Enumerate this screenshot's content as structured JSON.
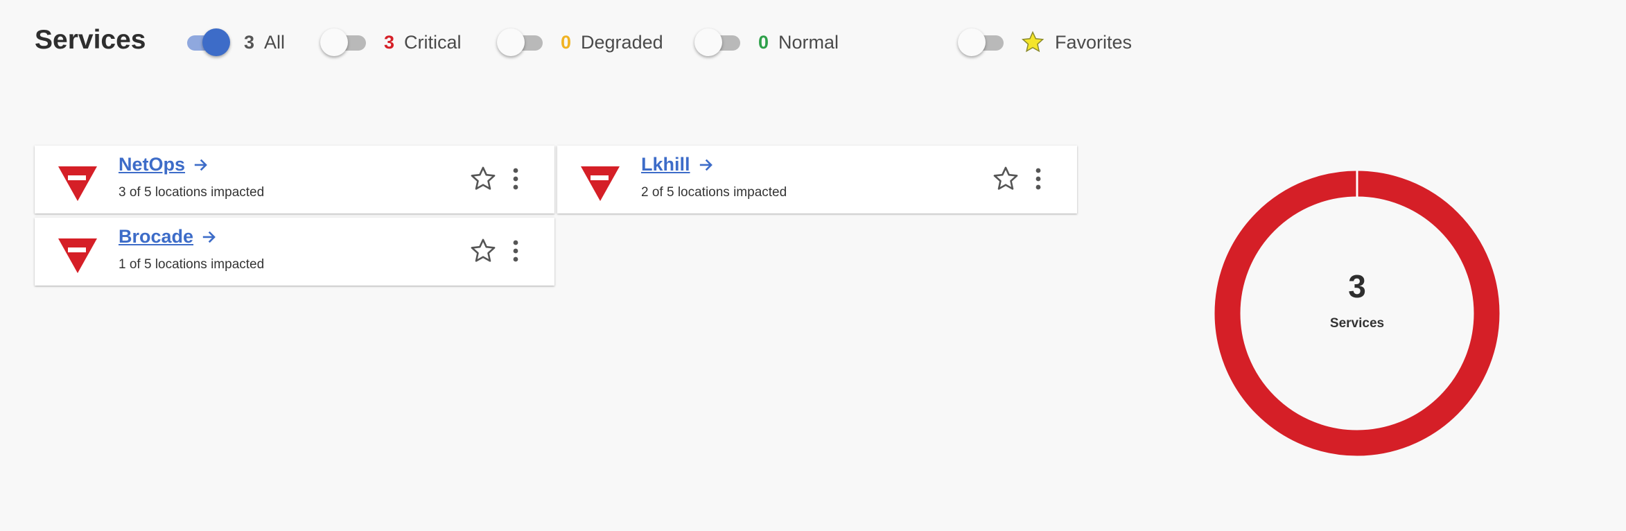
{
  "header": {
    "title": "Services"
  },
  "filters": [
    {
      "id": "all",
      "count": "3",
      "label": "All",
      "on": true,
      "count_color": "#555555"
    },
    {
      "id": "critical",
      "count": "3",
      "label": "Critical",
      "on": false,
      "count_color": "#d51f27"
    },
    {
      "id": "degraded",
      "count": "0",
      "label": "Degraded",
      "on": false,
      "count_color": "#f0b323"
    },
    {
      "id": "normal",
      "count": "0",
      "label": "Normal",
      "on": false,
      "count_color": "#2ea04a"
    },
    {
      "id": "favorites",
      "label": "Favorites",
      "on": false,
      "icon": "star-icon"
    }
  ],
  "services": [
    {
      "name": "NetOps",
      "impact": "3 of 5 locations impacted",
      "status": "critical"
    },
    {
      "name": "Lkhill",
      "impact": "2 of 5 locations impacted",
      "status": "critical"
    },
    {
      "name": "Brocade",
      "impact": "1 of 5 locations impacted",
      "status": "critical"
    }
  ],
  "summary": {
    "count": "3",
    "label": "Services"
  },
  "chart_data": {
    "type": "pie",
    "categories": [
      "Critical",
      "Degraded",
      "Normal"
    ],
    "values": [
      3,
      0,
      0
    ],
    "colors": [
      "#d51f27",
      "#f0b323",
      "#2ea04a"
    ]
  },
  "colors": {
    "critical": "#d51f27",
    "accent": "#3d6cc8",
    "favorite_star": "#f5e52a"
  }
}
